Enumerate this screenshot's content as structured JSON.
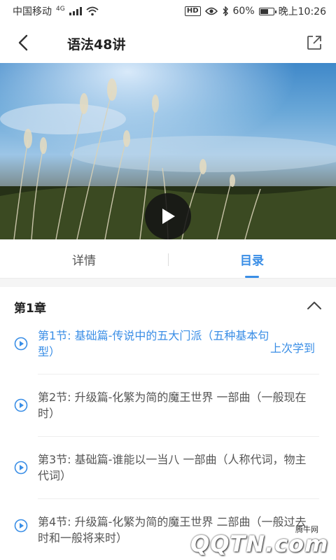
{
  "status_bar": {
    "carrier": "中国移动",
    "network": "4G",
    "battery": "60%",
    "battery_level": 0.6,
    "time": "晚上10:26",
    "icons": [
      "signal-icon",
      "wifi-icon",
      "hd-icon",
      "eye-icon",
      "bluetooth-icon",
      "battery-icon"
    ]
  },
  "header": {
    "title": "语法48讲",
    "back_icon": "chevron-left-icon",
    "share_icon": "share-icon"
  },
  "video": {
    "play_icon": "play-icon"
  },
  "tabs": [
    {
      "label": "详情",
      "active": false
    },
    {
      "label": "目录",
      "active": true
    }
  ],
  "accent_color": "#3a8ee6",
  "chapter": {
    "title": "第1章",
    "collapse_icon": "chevron-up-icon"
  },
  "lessons": [
    {
      "title": "第1节: 基础篇-传说中的五大门派（五种基本句型）",
      "active": true,
      "tag": "上次学到"
    },
    {
      "title": "第2节: 升级篇-化繁为简的魔王世界 一部曲（一般现在时）",
      "active": false
    },
    {
      "title": "第3节: 基础篇-谁能以一当八 一部曲（人称代词，物主代词）",
      "active": false
    },
    {
      "title": "第4节: 升级篇-化繁为简的魔王世界 二部曲（一般过去时和一般将来时）",
      "active": false
    }
  ],
  "watermark": {
    "small": "腾牛网",
    "logo": "QQTN.com"
  }
}
